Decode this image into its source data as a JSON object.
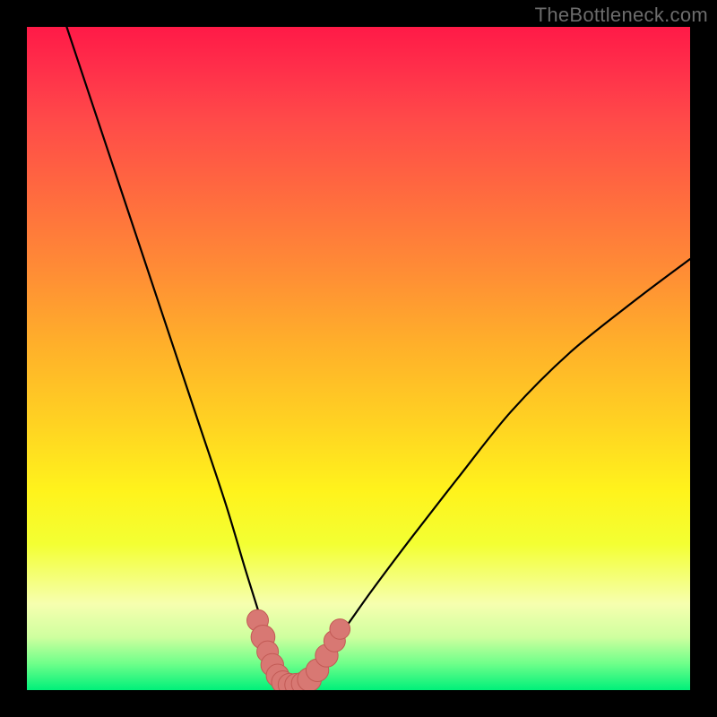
{
  "watermark": "TheBottleneck.com",
  "chart_data": {
    "type": "line",
    "title": "",
    "xlabel": "",
    "ylabel": "",
    "xlim": [
      0,
      100
    ],
    "ylim": [
      0,
      100
    ],
    "grid": false,
    "description": "V-shaped bottleneck curve on a vertical heat gradient (red=high bottleneck, green=low). Two black curves descend from top-left and top-right and meet near the bottom; the minimum region is highlighted with salmon markers.",
    "series": [
      {
        "name": "left-branch",
        "x": [
          6,
          10,
          14,
          18,
          22,
          26,
          30,
          33,
          35.5,
          37,
          38.2,
          39.2
        ],
        "y": [
          100,
          88,
          76,
          64,
          52,
          40,
          28,
          18,
          10,
          5,
          2,
          0.5
        ]
      },
      {
        "name": "right-branch",
        "x": [
          39.2,
          43,
          47,
          52,
          58,
          65,
          73,
          82,
          92,
          100
        ],
        "y": [
          0.5,
          3,
          8,
          15,
          23,
          32,
          42,
          51,
          59,
          65
        ]
      }
    ],
    "markers": [
      {
        "x": 34.8,
        "y": 10.5,
        "r": 1.2
      },
      {
        "x": 35.6,
        "y": 8.0,
        "r": 1.4
      },
      {
        "x": 36.3,
        "y": 5.8,
        "r": 1.2
      },
      {
        "x": 37.0,
        "y": 3.8,
        "r": 1.3
      },
      {
        "x": 37.8,
        "y": 2.2,
        "r": 1.3
      },
      {
        "x": 38.6,
        "y": 1.2,
        "r": 1.3
      },
      {
        "x": 39.6,
        "y": 0.8,
        "r": 1.3
      },
      {
        "x": 40.6,
        "y": 0.8,
        "r": 1.3
      },
      {
        "x": 41.6,
        "y": 1.0,
        "r": 1.3
      },
      {
        "x": 42.6,
        "y": 1.6,
        "r": 1.4
      },
      {
        "x": 43.8,
        "y": 3.0,
        "r": 1.3
      },
      {
        "x": 45.2,
        "y": 5.2,
        "r": 1.3
      },
      {
        "x": 46.4,
        "y": 7.4,
        "r": 1.2
      },
      {
        "x": 47.2,
        "y": 9.2,
        "r": 1.1
      }
    ],
    "colors": {
      "curve": "#000000",
      "marker_fill": "#d87873",
      "marker_stroke": "#c25a55"
    }
  }
}
